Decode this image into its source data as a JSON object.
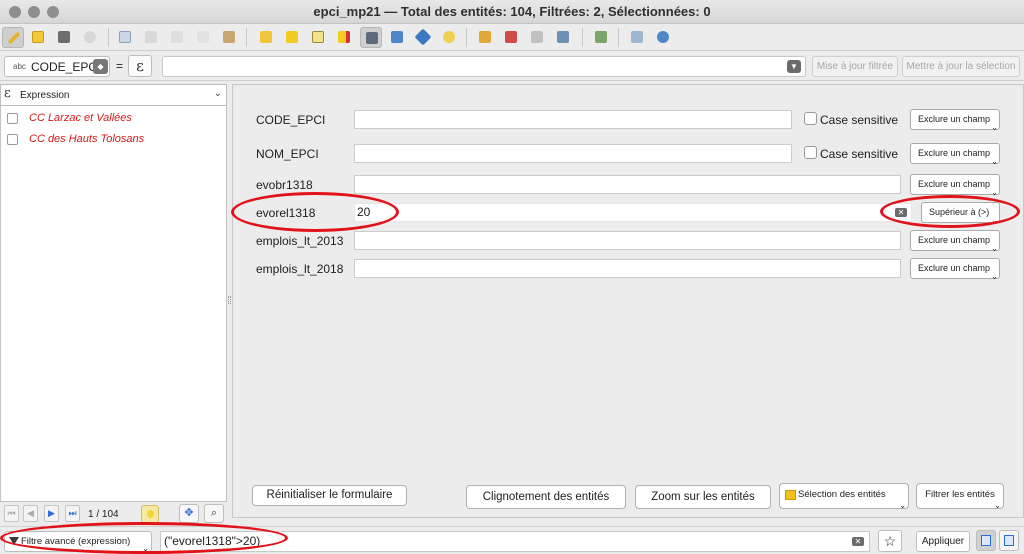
{
  "window": {
    "title": "epci_mp21 — Total des entités: 104, Filtrées: 2, Sélectionnées: 0"
  },
  "toolbar": {
    "icons": [
      "edit-pencil-icon",
      "multi-edit-icon",
      "save-icon",
      "reload-icon",
      "add-feature-icon",
      "delete-icon",
      "cut-icon",
      "copy-icon",
      "paste-icon",
      "expression-select-icon",
      "select-all-icon",
      "invert-selection-icon",
      "deselect-icon",
      "filter-select-icon",
      "move-top-icon",
      "pan-to-icon",
      "zoom-to-icon",
      "new-field-icon",
      "delete-field-icon",
      "field-calculator-icon",
      "conditional-format-icon",
      "dock-icon",
      "actions-icon",
      "form-icon"
    ]
  },
  "filter_bar": {
    "field_type": "abc",
    "field": "CODE_EPCI",
    "equals": "=",
    "expression_symbol": "ε",
    "quick_filter_value": "",
    "update_filtered_label": "Mise à jour filtrée",
    "update_selection_label": "Mettre à jour la sélection"
  },
  "left_panel": {
    "expression_symbol": "ε",
    "display_mode": "Expression",
    "features": [
      "CC Larzac et Vallées",
      "CC des Hauts Tolosans"
    ],
    "pager": "1 / 104"
  },
  "form": {
    "fields": [
      {
        "label": "CODE_EPCI",
        "value": "",
        "case_sensitive": "Case sensitive",
        "mode": "Exclure un champ"
      },
      {
        "label": "NOM_EPCI",
        "value": "",
        "case_sensitive": "Case sensitive",
        "mode": "Exclure un champ"
      },
      {
        "label": "evobr1318",
        "value": "",
        "mode": "Exclure un champ"
      },
      {
        "label": "evorel1318",
        "value": "20",
        "mode": "Supérieur à (>)"
      },
      {
        "label": "emplois_lt_2013",
        "value": "",
        "mode": "Exclure un champ"
      },
      {
        "label": "emplois_lt_2018",
        "value": "",
        "mode": "Exclure un champ"
      }
    ],
    "buttons": {
      "reset": "Réinitialiser le formulaire",
      "flash": "Clignotement des entités",
      "zoom": "Zoom sur les entités",
      "select": "Sélection des entités",
      "filter": "Filtrer les entités"
    }
  },
  "bottom_bar": {
    "filter_mode": "Filtre avancé (expression)",
    "expression": "(\"evorel1318\">20)",
    "apply_label": "Appliquer"
  },
  "colors": {
    "highlight_red": "#e1131a",
    "feature_text": "#d21a1a",
    "accent_blue": "#2a6dd6"
  }
}
